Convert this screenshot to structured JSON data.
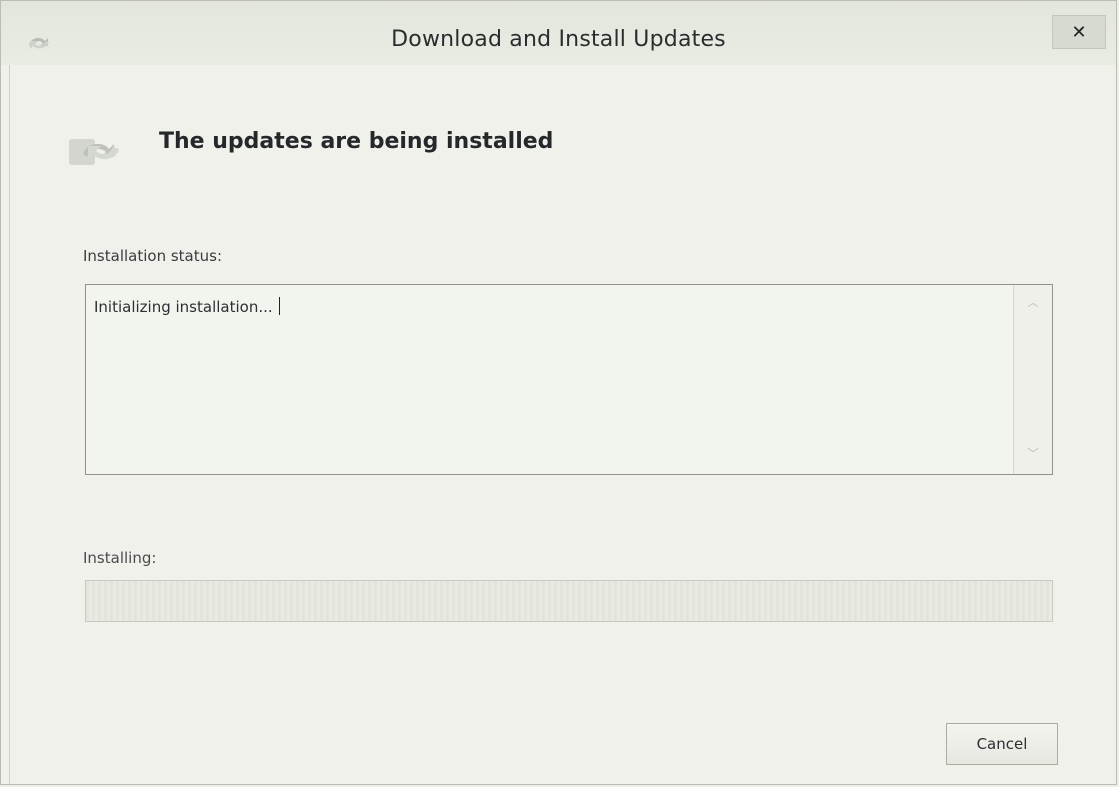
{
  "window": {
    "title": "Download and Install Updates",
    "close_label": "✕"
  },
  "header": {
    "heading": "The updates are being installed"
  },
  "status": {
    "label": "Installation status:",
    "text": "Initializing installation..."
  },
  "installing": {
    "label": "Installing:",
    "progress_percent": 0
  },
  "actions": {
    "cancel_label": "Cancel"
  },
  "icons": {
    "title": "windows-update-icon",
    "header": "windows-update-icon",
    "close": "close-icon"
  }
}
